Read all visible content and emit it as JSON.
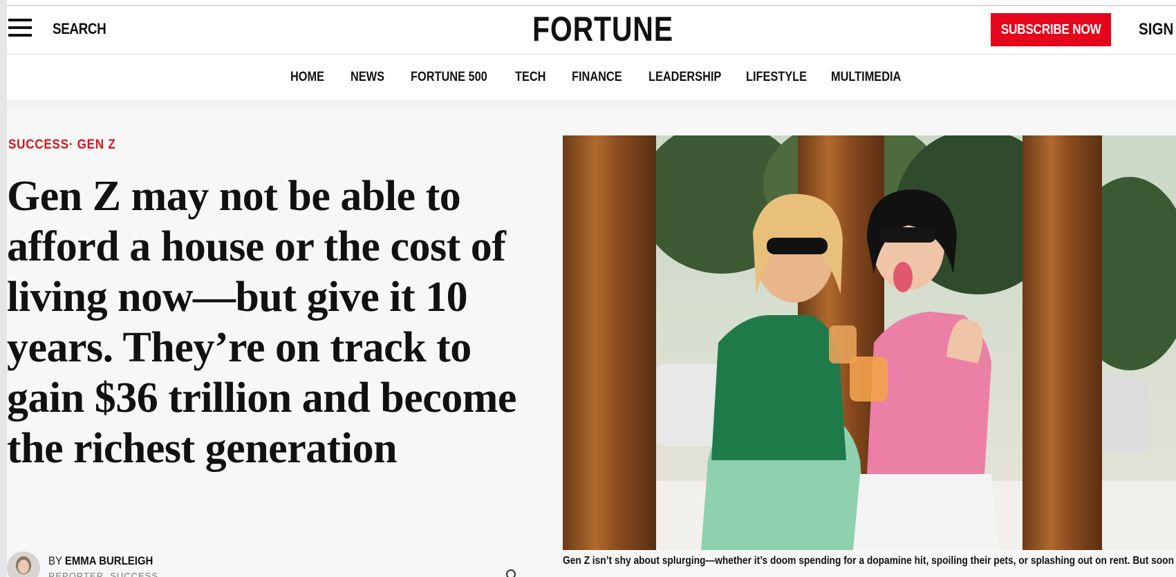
{
  "header": {
    "search_label": "SEARCH",
    "logo_text": "FORTUNE",
    "subscribe_label": "SUBSCRIBE NOW",
    "signin_label": "SIGN IN",
    "icons": {
      "menu": "hamburger-menu-icon"
    }
  },
  "nav": {
    "items": [
      {
        "label": "HOME"
      },
      {
        "label": "NEWS"
      },
      {
        "label": "FORTUNE 500"
      },
      {
        "label": "TECH"
      },
      {
        "label": "FINANCE"
      },
      {
        "label": "LEADERSHIP"
      },
      {
        "label": "LIFESTYLE"
      },
      {
        "label": "MULTIMEDIA"
      }
    ]
  },
  "article": {
    "section_primary": "SUCCESS",
    "section_separator": "·",
    "section_secondary": "GEN Z",
    "headline": "Gen Z may not be able to afford a house or the cost of living now—but give it 10 years. They’re on track to gain $36 trillion and become the richest generation",
    "byline_prefix": "BY",
    "author": "EMMA BURLEIGH",
    "role": "REPORTER, SUCCESS",
    "image_caption": "Gen Z isn’t shy about splurging—whether it’s doom spending for a dopamine hit, spoiling their pets, or splashing out on rent. But soon they’ll actually have the financial power to afford it."
  },
  "colors": {
    "brand_red": "#e4061b",
    "kicker_red": "#d8141d",
    "text": "#111111",
    "background": "#f7f7f7"
  }
}
